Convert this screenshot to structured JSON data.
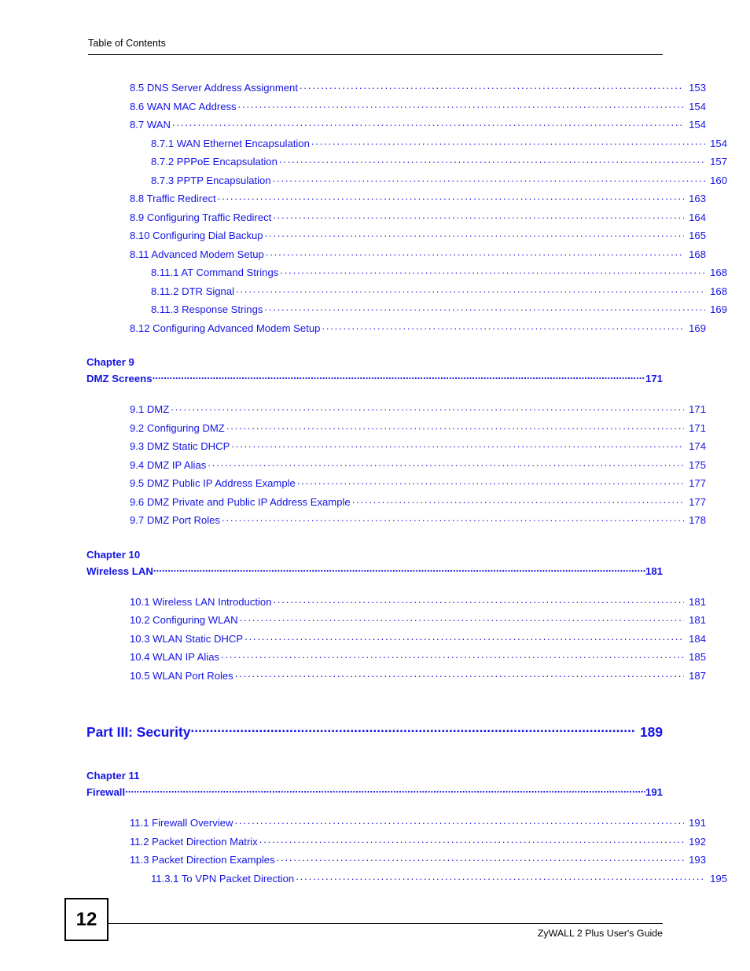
{
  "header": {
    "title": "Table of Contents"
  },
  "footer": {
    "page_number": "12",
    "guide_title": "ZyWALL 2 Plus User's Guide"
  },
  "toc": {
    "entries": [
      {
        "level": 1,
        "label": "8.5   DNS Server Address Assignment ",
        "page": "153"
      },
      {
        "level": 1,
        "label": "8.6 WAN MAC Address",
        "page": "154"
      },
      {
        "level": 1,
        "label": "8.7 WAN    ",
        "page": "154"
      },
      {
        "level": 2,
        "label": "8.7.1 WAN Ethernet Encapsulation",
        "page": "154"
      },
      {
        "level": 2,
        "label": "8.7.2 PPPoE Encapsulation ",
        "page": "157"
      },
      {
        "level": 2,
        "label": "8.7.3 PPTP Encapsulation ",
        "page": "160"
      },
      {
        "level": 1,
        "label": "8.8 Traffic Redirect   ",
        "page": "163"
      },
      {
        "level": 1,
        "label": "8.9 Configuring Traffic Redirect ",
        "page": "164"
      },
      {
        "level": 1,
        "label": "8.10 Configuring Dial Backup ",
        "page": "165"
      },
      {
        "level": 1,
        "label": "8.11 Advanced Modem Setup  ",
        "page": "168"
      },
      {
        "level": 2,
        "label": "8.11.1 AT Command Strings  ",
        "page": "168"
      },
      {
        "level": 2,
        "label": "8.11.2 DTR Signal ",
        "page": "168"
      },
      {
        "level": 2,
        "label": "8.11.3 Response Strings  ",
        "page": "169"
      },
      {
        "level": 1,
        "label": "8.12 Configuring Advanced Modem Setup ",
        "page": "169"
      }
    ],
    "chapter9": {
      "chapter_line": "Chapter  9",
      "title": "DMZ Screens ",
      "page": "171",
      "entries": [
        {
          "level": 1,
          "label": "9.1 DMZ   ",
          "page": "171"
        },
        {
          "level": 1,
          "label": "9.2 Configuring DMZ ",
          "page": "171"
        },
        {
          "level": 1,
          "label": "9.3 DMZ Static DHCP  ",
          "page": "174"
        },
        {
          "level": 1,
          "label": "9.4 DMZ IP Alias  ",
          "page": "175"
        },
        {
          "level": 1,
          "label": "9.5 DMZ Public IP Address Example ",
          "page": "177"
        },
        {
          "level": 1,
          "label": "9.6 DMZ Private and Public IP Address Example ",
          "page": "177"
        },
        {
          "level": 1,
          "label": "9.7 DMZ Port Roles   ",
          "page": "178"
        }
      ]
    },
    "chapter10": {
      "chapter_line": "Chapter  10",
      "title": "Wireless LAN",
      "page": "181",
      "entries": [
        {
          "level": 1,
          "label": "10.1 Wireless LAN Introduction ",
          "page": "181"
        },
        {
          "level": 1,
          "label": "10.2 Configuring WLAN   ",
          "page": "181"
        },
        {
          "level": 1,
          "label": "10.3 WLAN Static DHCP   ",
          "page": "184"
        },
        {
          "level": 1,
          "label": "10.4 WLAN IP Alias   ",
          "page": "185"
        },
        {
          "level": 1,
          "label": "10.5 WLAN Port Roles  ",
          "page": "187"
        }
      ]
    },
    "part3": {
      "title": "Part III: Security",
      "page": "189"
    },
    "chapter11": {
      "chapter_line": "Chapter  11",
      "title": "Firewall",
      "page": "191",
      "entries": [
        {
          "level": 1,
          "label": "11.1 Firewall Overview  ",
          "page": "191"
        },
        {
          "level": 1,
          "label": "11.2 Packet Direction Matrix ",
          "page": "192"
        },
        {
          "level": 1,
          "label": "11.3 Packet Direction Examples ",
          "page": "193"
        },
        {
          "level": 2,
          "label": "11.3.1 To VPN Packet Direction ",
          "page": "195"
        }
      ]
    }
  }
}
